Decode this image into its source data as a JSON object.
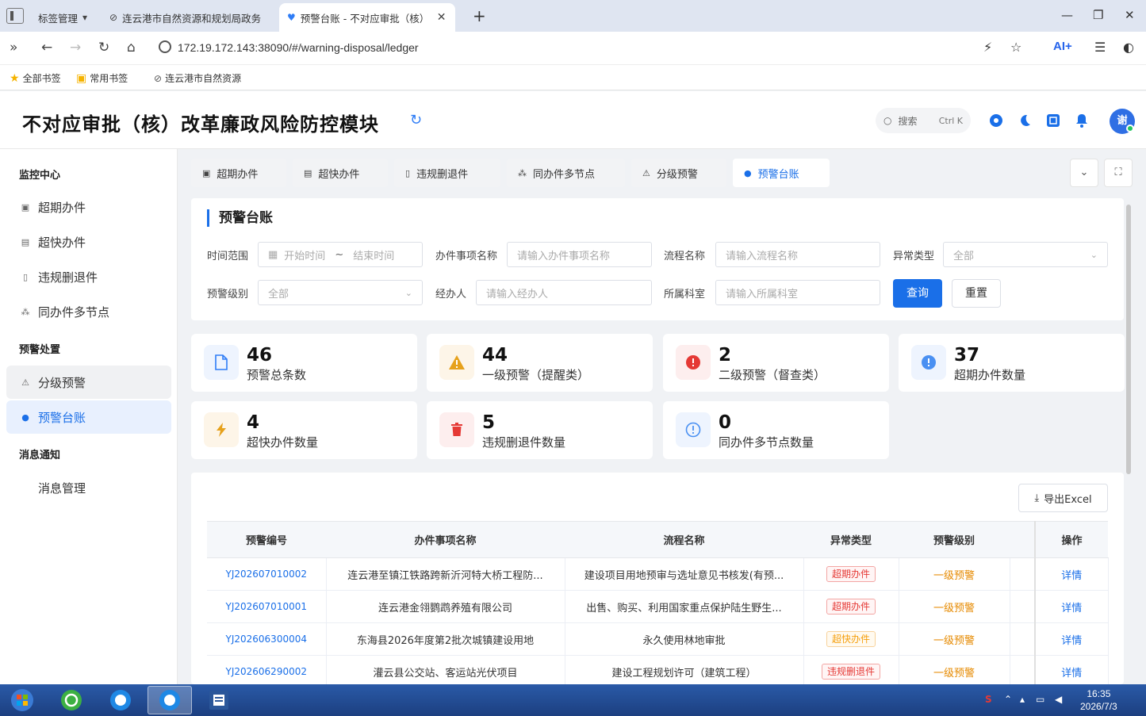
{
  "browser": {
    "tabs": [
      {
        "label": "标签管理"
      },
      {
        "label": "连云港市自然资源和规划局政务"
      },
      {
        "label": "预警台账 - 不对应审批（核）改"
      }
    ],
    "url": "172.19.172.143:38090/#/warning-disposal/ledger",
    "ai_label": "AI+",
    "bookmarks": [
      "全部书签",
      "常用书签",
      "连云港市自然资源"
    ]
  },
  "app": {
    "title": "不对应审批（核）改革廉政风险防控模块",
    "search_placeholder": "搜索",
    "search_shortcut": "Ctrl K",
    "avatar_text": "谢"
  },
  "sidebar": {
    "groups": [
      {
        "title": "监控中心",
        "items": [
          "超期办件",
          "超快办件",
          "违规删退件",
          "同办件多节点"
        ]
      },
      {
        "title": "预警处置",
        "items": [
          "分级预警",
          "预警台账"
        ]
      },
      {
        "title": "消息通知",
        "items": [
          "消息管理"
        ]
      }
    ]
  },
  "content_tabs": [
    "超期办件",
    "超快办件",
    "违规删退件",
    "同办件多节点",
    "分级预警",
    "预警台账"
  ],
  "filter": {
    "title": "预警台账",
    "time_range_label": "时间范围",
    "start_placeholder": "开始时间",
    "range_sep": "~",
    "end_placeholder": "结束时间",
    "item_name_label": "办件事项名称",
    "item_name_placeholder": "请输入办件事项名称",
    "process_label": "流程名称",
    "process_placeholder": "请输入流程名称",
    "anomaly_label": "异常类型",
    "anomaly_value": "全部",
    "level_label": "预警级别",
    "level_value": "全部",
    "handler_label": "经办人",
    "handler_placeholder": "请输入经办人",
    "dept_label": "所属科室",
    "dept_placeholder": "请输入所属科室",
    "query_label": "查询",
    "reset_label": "重置"
  },
  "stats": [
    {
      "value": "46",
      "label": "预警总条数"
    },
    {
      "value": "44",
      "label": "一级预警（提醒类）"
    },
    {
      "value": "2",
      "label": "二级预警（督查类）"
    },
    {
      "value": "37",
      "label": "超期办件数量"
    },
    {
      "value": "4",
      "label": "超快办件数量"
    },
    {
      "value": "5",
      "label": "违规删退件数量"
    },
    {
      "value": "0",
      "label": "同办件多节点数量"
    }
  ],
  "table": {
    "export_label": "导出Excel",
    "headers": [
      "预警编号",
      "办件事项名称",
      "流程名称",
      "异常类型",
      "预警级别",
      "",
      "操作"
    ],
    "rows": [
      {
        "id": "YJ202607010002",
        "item": "连云港至镇江铁路跨新沂河特大桥工程防...",
        "process": "建设项目用地预审与选址意见书核发(有预...",
        "type": "超期办件",
        "level": "一级预警",
        "action": "详情"
      },
      {
        "id": "YJ202607010001",
        "item": "连云港金翎鹦鹉养殖有限公司",
        "process": "出售、购买、利用国家重点保护陆生野生...",
        "type": "超期办件",
        "level": "一级预警",
        "action": "详情"
      },
      {
        "id": "YJ202606300004",
        "item": "东海县2026年度第2批次城镇建设用地",
        "process": "永久使用林地审批",
        "type": "超快办件",
        "level": "一级预警",
        "action": "详情"
      },
      {
        "id": "YJ202606290002",
        "item": "灌云县公交站、客运站光伏项目",
        "process": "建设工程规划许可（建筑工程）",
        "type": "违规删退件",
        "level": "一级预警",
        "action": "详情"
      }
    ]
  },
  "taskbar": {
    "time": "16:35",
    "date": "2026/7/3"
  },
  "colors": {
    "primary": "#1a6fe8",
    "overdue": "#e53935",
    "fast": "#f59e0b",
    "deleted": "#e53935",
    "level1": "#e68a00"
  }
}
